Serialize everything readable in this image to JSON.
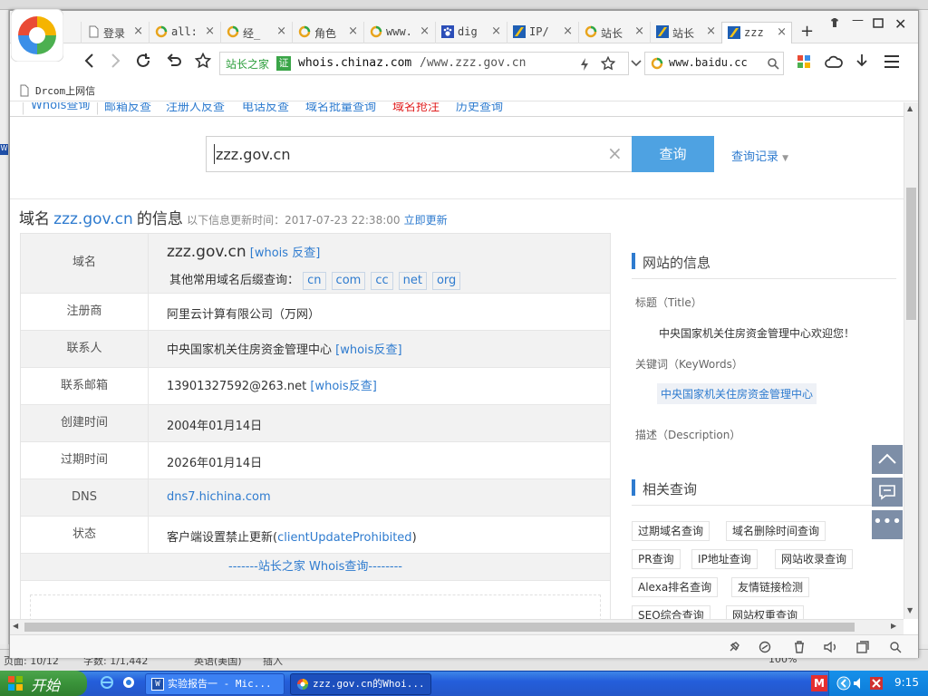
{
  "bg_status": {
    "page": "页面: 10/12",
    "words": "字数: 1/1,442",
    "lang": "英语(美国)",
    "mode": "插入",
    "zoom": "100%"
  },
  "tabs": [
    {
      "label": "登录",
      "icon": "page-icon"
    },
    {
      "label": "all:",
      "icon": "search-ring-icon"
    },
    {
      "label": "经_",
      "icon": "search-ring-icon"
    },
    {
      "label": "角色",
      "icon": "search-ring-icon"
    },
    {
      "label": "www.",
      "icon": "search-ring-icon"
    },
    {
      "label": "dig",
      "icon": "paw-icon"
    },
    {
      "label": "IP/",
      "icon": "chinaz-icon"
    },
    {
      "label": "站长",
      "icon": "search-ring-icon"
    },
    {
      "label": "站长",
      "icon": "chinaz-icon"
    },
    {
      "label": "zzz",
      "icon": "chinaz-icon"
    }
  ],
  "toolbar": {
    "site_name": "站长之家",
    "cert_badge": "证",
    "url_host": "whois.chinaz.com",
    "url_path": "/www.zzz.gov.cn",
    "search_value": "www.baidu.cc"
  },
  "bookmarks": {
    "item1": "Drcom上网信"
  },
  "nav_tabs": {
    "whois": "Whois查询",
    "email": "邮箱反查",
    "registrant": "注册人反查",
    "phone": "电话反查",
    "batch": "域名批量查询",
    "snatch": "域名抢注",
    "history": "历史查询"
  },
  "search": {
    "value": "zzz.gov.cn",
    "button": "查询",
    "history": "查询记录"
  },
  "heading": {
    "prefix": "域名",
    "domain": "zzz.gov.cn",
    "suffix": "的信息",
    "update_label": "以下信息更新时间：2017-07-23 22:38:00",
    "update_link": "立即更新"
  },
  "info": {
    "domain_key": "域名",
    "domain_value": "zzz.gov.cn",
    "whois_link": "[whois 反查]",
    "suffix_label": "其他常用域名后缀查询：",
    "suffixes": [
      "cn",
      "com",
      "cc",
      "net",
      "org"
    ],
    "registrar_key": "注册商",
    "registrar_value": "阿里云计算有限公司（万网）",
    "contact_key": "联系人",
    "contact_value": "中央国家机关住房资金管理中心",
    "contact_link": "[whois反查]",
    "email_key": "联系邮箱",
    "email_value": "13901327592@263.net",
    "email_link": "[whois反查]",
    "created_key": "创建时间",
    "created_value": "2004年01月14日",
    "expire_key": "过期时间",
    "expire_value": "2026年01月14日",
    "dns_key": "DNS",
    "dns_value": "dns7.hichina.com",
    "status_key": "状态",
    "status_text": "客户端设置禁止更新(",
    "status_code": "clientUpdateProhibited",
    "status_close": ")",
    "footer_link": "-------站长之家 Whois查询--------"
  },
  "sidebar": {
    "site_info_title": "网站的信息",
    "title_label": "标题（Title）",
    "title_value": "中央国家机关住房资金管理中心欢迎您！",
    "keywords_label": "关键词（KeyWords）",
    "keywords_value": "中央国家机关住房资金管理中心",
    "desc_label": "描述（Description）",
    "related_title": "相关查询",
    "related": [
      "过期域名查询",
      "域名删除时间查询",
      "PR查询",
      "IP地址查询",
      "网站收录查询",
      "Alexa排名查询",
      "友情链接检测",
      "SEO综合查询",
      "网站权重查询"
    ]
  },
  "taskbar": {
    "start": "开始",
    "task1": "实验报告一 - Mic...",
    "task2": "zzz.gov.cn的Whoi...",
    "clock": "9:15"
  },
  "colors": {
    "link": "#2e7bcf",
    "search_button": "#4ea2e2",
    "row_gray": "#f2f2f2",
    "side_buttons": "#7d8ea7"
  }
}
